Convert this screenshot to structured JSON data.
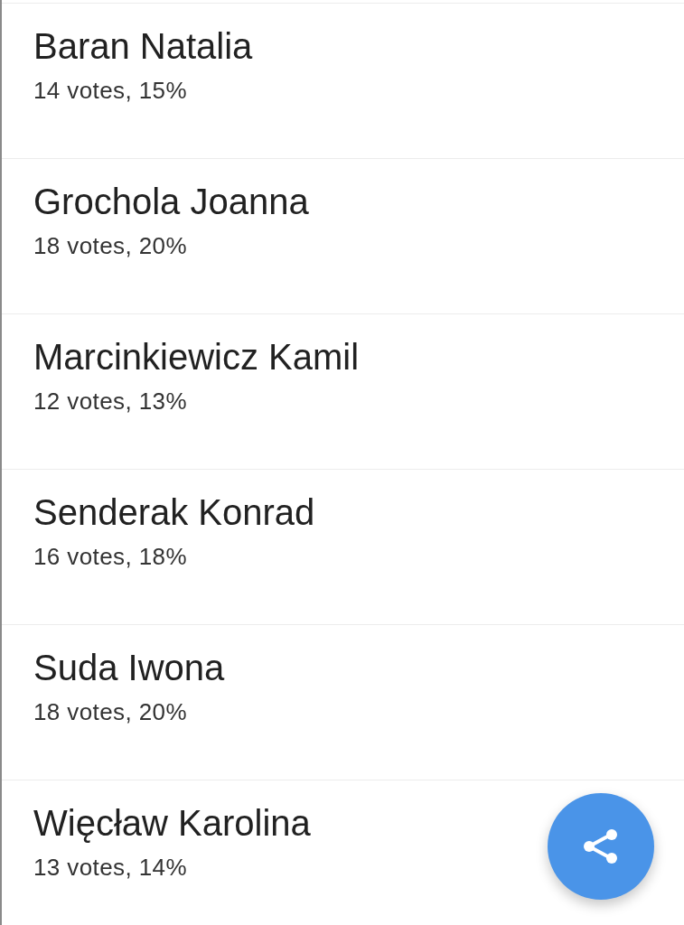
{
  "results": [
    {
      "name": "Baran Natalia",
      "votes": "14 votes, 15%"
    },
    {
      "name": "Grochola Joanna",
      "votes": "18 votes, 20%"
    },
    {
      "name": "Marcinkiewicz Kamil",
      "votes": "12 votes, 13%"
    },
    {
      "name": "Senderak Konrad",
      "votes": "16 votes, 18%"
    },
    {
      "name": "Suda Iwona",
      "votes": "18 votes, 20%"
    },
    {
      "name": "Więcław Karolina",
      "votes": "13 votes, 14%"
    }
  ]
}
